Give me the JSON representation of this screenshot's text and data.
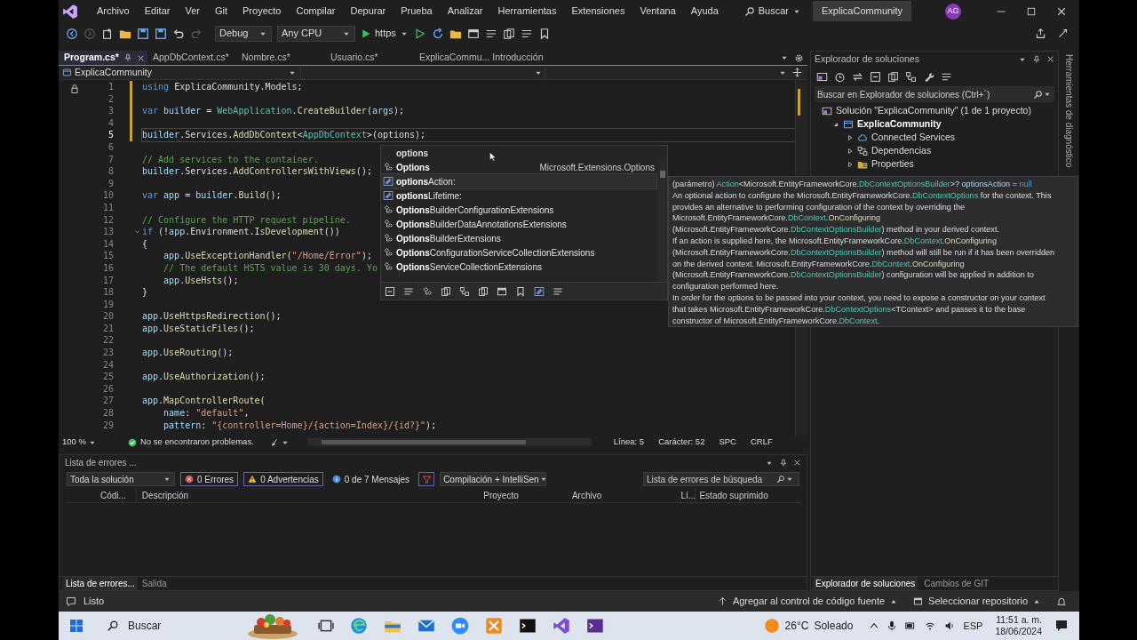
{
  "menu": {
    "items": [
      "Archivo",
      "Editar",
      "Ver",
      "Git",
      "Proyecto",
      "Compilar",
      "Depurar",
      "Prueba",
      "Analizar",
      "Herramientas",
      "Extensiones",
      "Ventana",
      "Ayuda"
    ],
    "search": "Buscar",
    "solution_name": "ExplicaCommunity",
    "avatar": "AG"
  },
  "toolbar": {
    "configuration": "Debug",
    "platform": "Any CPU",
    "launch_profile": "https"
  },
  "tabs": [
    {
      "label": "Program.cs*",
      "selected": true
    },
    {
      "label": "AppDbContext.cs*",
      "selected": false
    },
    {
      "label": "Nombre.cs*",
      "selected": false
    },
    {
      "label": "Usuario.cs*",
      "selected": false
    },
    {
      "label": "ExplicaCommu... Introducción",
      "selected": false
    }
  ],
  "nav_bar": {
    "project": "ExplicaCommunity"
  },
  "editor": {
    "lines": [
      {
        "number": "1",
        "changed": true,
        "tokens": [
          {
            "kind": "kw",
            "text": "using"
          },
          {
            "kind": "plain",
            "text": " ExplicaCommunity.Models;"
          }
        ]
      },
      {
        "number": "2",
        "changed": true
      },
      {
        "number": "3",
        "changed": true,
        "tokens": [
          {
            "kind": "kw",
            "text": "var"
          },
          {
            "kind": "local",
            "text": " builder"
          },
          {
            "kind": "plain",
            "text": " = "
          },
          {
            "kind": "type",
            "text": "WebApplication"
          },
          {
            "kind": "plain",
            "text": "."
          },
          {
            "kind": "method",
            "text": "CreateBuilder"
          },
          {
            "kind": "plain",
            "text": "("
          },
          {
            "kind": "local",
            "text": "args"
          },
          {
            "kind": "plain",
            "text": ");"
          }
        ]
      },
      {
        "number": "4",
        "changed": true
      },
      {
        "number": "5",
        "changed": true,
        "current": true,
        "tokens": [
          {
            "kind": "local",
            "text": "builder"
          },
          {
            "kind": "plain",
            "text": ".Services."
          },
          {
            "kind": "method",
            "text": "AddDbContext"
          },
          {
            "kind": "plain",
            "text": "<"
          },
          {
            "kind": "type",
            "text": "AppDbContext"
          },
          {
            "kind": "plain",
            "text": ">(options);"
          }
        ]
      },
      {
        "number": "6"
      },
      {
        "number": "7",
        "tokens": [
          {
            "kind": "comment",
            "text": "// Add services to the container."
          }
        ]
      },
      {
        "number": "8",
        "tokens": [
          {
            "kind": "local",
            "text": "builder"
          },
          {
            "kind": "plain",
            "text": ".Services."
          },
          {
            "kind": "method",
            "text": "AddControllersWithViews"
          },
          {
            "kind": "plain",
            "text": "();"
          }
        ]
      },
      {
        "number": "9"
      },
      {
        "number": "10",
        "tokens": [
          {
            "kind": "kw",
            "text": "var"
          },
          {
            "kind": "local",
            "text": " app"
          },
          {
            "kind": "plain",
            "text": " = "
          },
          {
            "kind": "local",
            "text": "builder"
          },
          {
            "kind": "plain",
            "text": "."
          },
          {
            "kind": "method",
            "text": "Build"
          },
          {
            "kind": "plain",
            "text": "();"
          }
        ]
      },
      {
        "number": "11"
      },
      {
        "number": "12",
        "tokens": [
          {
            "kind": "comment",
            "text": "// Configure the HTTP request pipeline."
          }
        ]
      },
      {
        "number": "13",
        "fold": true,
        "tokens": [
          {
            "kind": "kw",
            "text": "if"
          },
          {
            "kind": "plain",
            "text": " (!"
          },
          {
            "kind": "local",
            "text": "app"
          },
          {
            "kind": "plain",
            "text": ".Environment."
          },
          {
            "kind": "method",
            "text": "IsDevelopment"
          },
          {
            "kind": "plain",
            "text": "())"
          }
        ]
      },
      {
        "number": "14",
        "tokens": [
          {
            "kind": "plain",
            "text": "{"
          }
        ]
      },
      {
        "number": "15",
        "tokens": [
          {
            "kind": "local",
            "text": "    app"
          },
          {
            "kind": "plain",
            "text": "."
          },
          {
            "kind": "method",
            "text": "UseExceptionHandler"
          },
          {
            "kind": "plain",
            "text": "("
          },
          {
            "kind": "string",
            "text": "\"/Home/Error\""
          },
          {
            "kind": "plain",
            "text": ");"
          }
        ]
      },
      {
        "number": "16",
        "tokens": [
          {
            "kind": "comment",
            "text": "    // The default HSTS value is 30 days. Yo"
          }
        ]
      },
      {
        "number": "17",
        "tokens": [
          {
            "kind": "local",
            "text": "    app"
          },
          {
            "kind": "plain",
            "text": "."
          },
          {
            "kind": "method",
            "text": "UseHsts"
          },
          {
            "kind": "plain",
            "text": "();"
          }
        ]
      },
      {
        "number": "18",
        "tokens": [
          {
            "kind": "plain",
            "text": "}"
          }
        ]
      },
      {
        "number": "19"
      },
      {
        "number": "20",
        "tokens": [
          {
            "kind": "local",
            "text": "app"
          },
          {
            "kind": "plain",
            "text": "."
          },
          {
            "kind": "method",
            "text": "UseHttpsRedirection"
          },
          {
            "kind": "plain",
            "text": "();"
          }
        ]
      },
      {
        "number": "21",
        "tokens": [
          {
            "kind": "local",
            "text": "app"
          },
          {
            "kind": "plain",
            "text": "."
          },
          {
            "kind": "method",
            "text": "UseStaticFiles"
          },
          {
            "kind": "plain",
            "text": "();"
          }
        ]
      },
      {
        "number": "22"
      },
      {
        "number": "23",
        "tokens": [
          {
            "kind": "local",
            "text": "app"
          },
          {
            "kind": "plain",
            "text": "."
          },
          {
            "kind": "method",
            "text": "UseRouting"
          },
          {
            "kind": "plain",
            "text": "();"
          }
        ]
      },
      {
        "number": "24"
      },
      {
        "number": "25",
        "tokens": [
          {
            "kind": "local",
            "text": "app"
          },
          {
            "kind": "plain",
            "text": "."
          },
          {
            "kind": "method",
            "text": "UseAuthorization"
          },
          {
            "kind": "plain",
            "text": "();"
          }
        ]
      },
      {
        "number": "26"
      },
      {
        "number": "27",
        "tokens": [
          {
            "kind": "local",
            "text": "app"
          },
          {
            "kind": "plain",
            "text": "."
          },
          {
            "kind": "method",
            "text": "MapControllerRoute"
          },
          {
            "kind": "plain",
            "text": "("
          }
        ]
      },
      {
        "number": "28",
        "tokens": [
          {
            "kind": "local",
            "text": "    name"
          },
          {
            "kind": "plain",
            "text": ": "
          },
          {
            "kind": "string",
            "text": "\"default\""
          },
          {
            "kind": "plain",
            "text": ","
          }
        ]
      },
      {
        "number": "29",
        "tokens": [
          {
            "kind": "local",
            "text": "    pattern"
          },
          {
            "kind": "plain",
            "text": ": "
          },
          {
            "kind": "string",
            "text": "\"{controller=Home}/{action=Index}/{id?}\""
          },
          {
            "kind": "plain",
            "text": ");"
          }
        ]
      }
    ]
  },
  "completion": {
    "filter": "options",
    "items": [
      {
        "kind": "class",
        "label": "Options",
        "namespace": "Microsoft.Extensions.Options",
        "selected": false
      },
      {
        "kind": "property",
        "label": "optionsAction:",
        "selected": true
      },
      {
        "kind": "property",
        "label": "optionsLifetime:",
        "selected": false
      },
      {
        "kind": "class",
        "label": "OptionsBuilderConfigurationExtensions",
        "selected": false
      },
      {
        "kind": "class",
        "label": "OptionsBuilderDataAnnotationsExtensions",
        "selected": false
      },
      {
        "kind": "class",
        "label": "OptionsBuilderExtensions",
        "selected": false
      },
      {
        "kind": "class",
        "label": "OptionsConfigurationServiceCollectionExtensions",
        "selected": false
      },
      {
        "kind": "class",
        "label": "OptionsServiceCollectionExtensions",
        "selected": false
      }
    ]
  },
  "tooltip": {
    "lines": [
      [
        {
          "kind": "plain",
          "text": "(parámetro) "
        },
        {
          "kind": "type",
          "text": "Action"
        },
        {
          "kind": "plain",
          "text": "<Microsoft.EntityFrameworkCore."
        },
        {
          "kind": "type",
          "text": "DbContextOptionsBuilder"
        },
        {
          "kind": "plain",
          "text": ">? "
        },
        {
          "kind": "param",
          "text": "optionsAction"
        },
        {
          "kind": "plain",
          "text": " = "
        },
        {
          "kind": "kw",
          "text": "null"
        }
      ],
      [
        {
          "kind": "plain",
          "text": "An optional action to configure the Microsoft.EntityFrameworkCore."
        },
        {
          "kind": "type",
          "text": "DbContextOptions"
        },
        {
          "kind": "plain",
          "text": " for the context. This"
        }
      ],
      [
        {
          "kind": "plain",
          "text": "provides an alternative to performing configuration of the context by overriding the"
        }
      ],
      [
        {
          "kind": "plain",
          "text": "Microsoft.EntityFrameworkCore."
        },
        {
          "kind": "type",
          "text": "DbContext"
        },
        {
          "kind": "plain",
          "text": "."
        },
        {
          "kind": "method",
          "text": "OnConfiguring"
        }
      ],
      [
        {
          "kind": "plain",
          "text": "(Microsoft.EntityFrameworkCore."
        },
        {
          "kind": "type",
          "text": "DbContextOptionsBuilder"
        },
        {
          "kind": "plain",
          "text": ") method in your derived context."
        }
      ],
      [
        {
          "kind": "plain",
          "text": "If an action is supplied here, the Microsoft.EntityFrameworkCore."
        },
        {
          "kind": "type",
          "text": "DbContext"
        },
        {
          "kind": "plain",
          "text": "."
        },
        {
          "kind": "method",
          "text": "OnConfiguring"
        }
      ],
      [
        {
          "kind": "plain",
          "text": "(Microsoft.EntityFrameworkCore."
        },
        {
          "kind": "type",
          "text": "DbContextOptionsBuilder"
        },
        {
          "kind": "plain",
          "text": ") method will still be run if it has been overridden"
        }
      ],
      [
        {
          "kind": "plain",
          "text": "on the derived context. Microsoft.EntityFrameworkCore."
        },
        {
          "kind": "type",
          "text": "DbContext"
        },
        {
          "kind": "plain",
          "text": "."
        },
        {
          "kind": "method",
          "text": "OnConfiguring"
        }
      ],
      [
        {
          "kind": "plain",
          "text": "(Microsoft.EntityFrameworkCore."
        },
        {
          "kind": "type",
          "text": "DbContextOptionsBuilder"
        },
        {
          "kind": "plain",
          "text": ") configuration will be applied in addition to"
        }
      ],
      [
        {
          "kind": "plain",
          "text": "configuration performed here."
        }
      ],
      [
        {
          "kind": "plain",
          "text": "In order for the options to be passed into your context, you need to expose a constructor on your context"
        }
      ],
      [
        {
          "kind": "plain",
          "text": "that takes Microsoft.EntityFrameworkCore."
        },
        {
          "kind": "type",
          "text": "DbContextOptions"
        },
        {
          "kind": "plain",
          "text": "<TContext> and passes it to the base"
        }
      ],
      [
        {
          "kind": "plain",
          "text": "constructor of Microsoft.EntityFrameworkCore."
        },
        {
          "kind": "type",
          "text": "DbContext"
        },
        {
          "kind": "plain",
          "text": "."
        }
      ]
    ]
  },
  "editor_status": {
    "zoom": "100 %",
    "problems": "No se encontraron problemas.",
    "line": "Línea: 5",
    "column": "Carácter: 52",
    "spacing": "SPC",
    "line_endings": "CRLF"
  },
  "error_list": {
    "title": "Lista de errores ...",
    "scope": "Toda la solución",
    "errors": "0 Errores",
    "warnings": "0 Advertencias",
    "messages": "0 de 7 Mensajes",
    "source": "Compilación + IntelliSen",
    "search_placeholder": "Lista de errores de búsqueda",
    "columns": [
      "Códi...",
      "Descripción",
      "Proyecto",
      "Archivo",
      "Lí...",
      "Estado suprimido"
    ]
  },
  "bottom_tabs": [
    {
      "label": "Lista de errores...",
      "selected": true
    },
    {
      "label": "Salida",
      "selected": false
    }
  ],
  "solution_explorer": {
    "title": "Explorador de soluciones",
    "search_placeholder": "Buscar en Explorador de soluciones (Ctrl+´)",
    "tree": [
      {
        "kind": "solution",
        "label": "Solución \"ExplicaCommunity\"  (1 de 1 proyecto)",
        "children": [
          {
            "kind": "project",
            "label": "ExplicaCommunity",
            "expanded": true,
            "children": [
              {
                "kind": "services",
                "label": "Connected Services",
                "expanded": false
              },
              {
                "kind": "dependencies",
                "label": "Dependencias",
                "expanded": false
              },
              {
                "kind": "folder",
                "label": "Properties",
                "expanded": false
              }
            ]
          }
        ]
      }
    ],
    "tabs": [
      {
        "label": "Explorador de soluciones",
        "selected": true
      },
      {
        "label": "Cambios de GIT",
        "selected": false
      }
    ]
  },
  "side_tab": "Herramientas de diagnóstico",
  "status_bar": {
    "text": "Listo",
    "source_control": "Agregar al control de código fuente",
    "repository": "Seleccionar repositorio"
  },
  "taskbar": {
    "search": "Buscar",
    "temperature": "26°C",
    "weather": "Soleado",
    "language": "ESP",
    "time": "11:51 a. m.",
    "date": "18/06/2024"
  }
}
